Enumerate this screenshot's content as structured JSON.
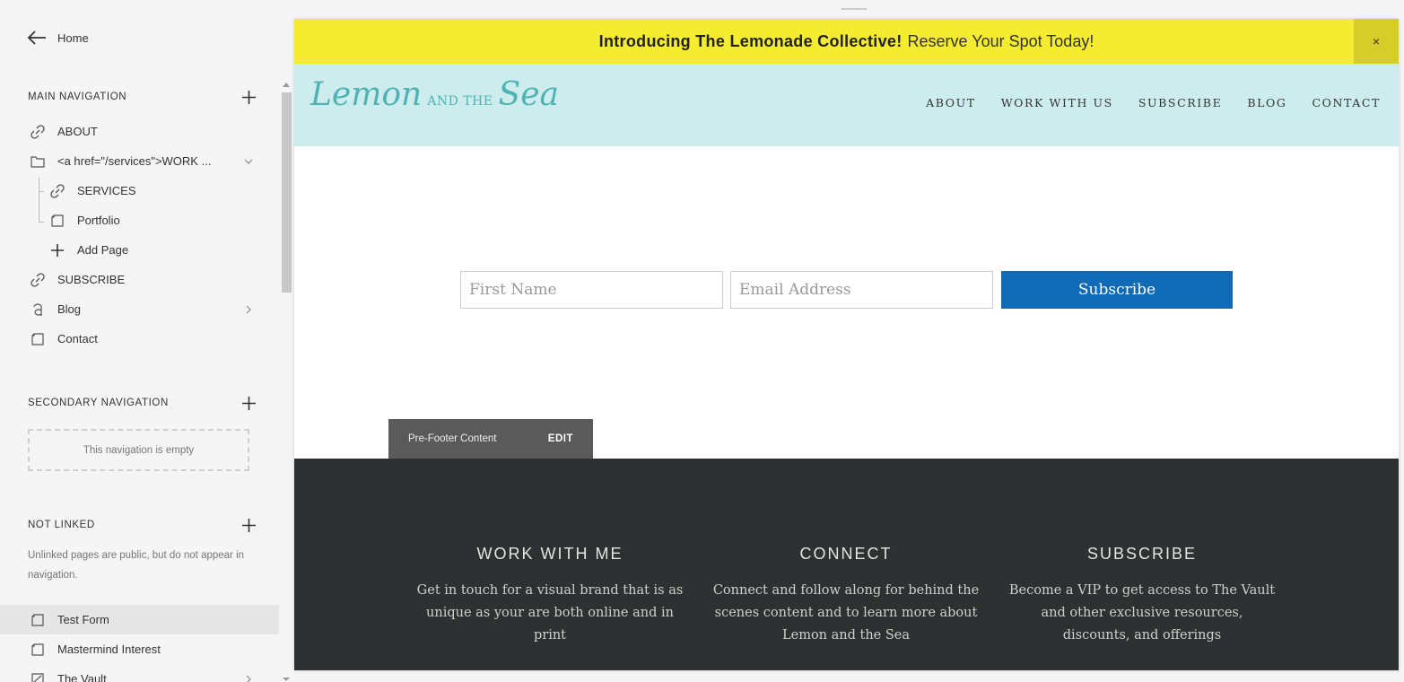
{
  "sidebar": {
    "home_label": "Home",
    "main_nav": {
      "title": "MAIN NAVIGATION",
      "items": [
        {
          "label": "ABOUT",
          "icon": "link-icon"
        },
        {
          "label": "<a href=\"/services\">WORK ...",
          "icon": "folder-icon"
        },
        {
          "label": "SERVICES",
          "icon": "link-icon"
        },
        {
          "label": "Portfolio",
          "icon": "page-icon"
        },
        {
          "label": "Add Page",
          "icon": "plus-icon"
        },
        {
          "label": "SUBSCRIBE",
          "icon": "link-icon"
        },
        {
          "label": "Blog",
          "icon": "blog-icon"
        },
        {
          "label": "Contact",
          "icon": "page-icon"
        }
      ]
    },
    "secondary_nav": {
      "title": "SECONDARY NAVIGATION",
      "empty_text": "This navigation is empty"
    },
    "not_linked": {
      "title": "NOT LINKED",
      "note": "Unlinked pages are public, but do not appear in navigation.",
      "items": [
        {
          "label": "Test Form",
          "icon": "page-icon"
        },
        {
          "label": "Mastermind Interest",
          "icon": "page-icon"
        },
        {
          "label": "The Vault",
          "icon": "page-icon"
        }
      ]
    }
  },
  "banner": {
    "bold": "Introducing The Lemonade Collective!",
    "rest": "Reserve Your Spot Today!",
    "close": "×"
  },
  "site": {
    "logo": {
      "part1": "Lemon",
      "part2": "AND THE",
      "part3": "Sea"
    },
    "nav": [
      "ABOUT",
      "WORK WITH US",
      "SUBSCRIBE",
      "BLOG",
      "CONTACT"
    ]
  },
  "form": {
    "first_name_placeholder": "First Name",
    "email_placeholder": "Email Address",
    "submit_label": "Subscribe"
  },
  "prefooter": {
    "label": "Pre-Footer Content",
    "edit": "EDIT"
  },
  "footer": {
    "columns": [
      {
        "title": "WORK WITH ME",
        "text": "Get in touch for a visual brand that is as unique as your are both online and in print"
      },
      {
        "title": "CONNECT",
        "text": "Connect and follow along for behind the scenes content and to learn more about Lemon and the Sea"
      },
      {
        "title": "SUBSCRIBE",
        "text": "Become a VIP to get access to The Vault and other exclusive resources, discounts, and offerings"
      }
    ]
  },
  "colors": {
    "banner_bg": "#f5ec32",
    "header_bg": "#cdeced",
    "button_bg": "#106ab5",
    "footer_bg": "#2d3132",
    "logo": "#4fb3b3"
  }
}
